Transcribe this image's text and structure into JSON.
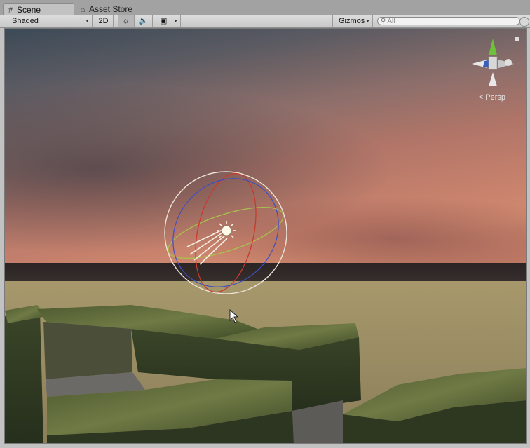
{
  "tabs": [
    {
      "label": "Scene",
      "icon": "grid-icon",
      "active": true
    },
    {
      "label": "Asset Store",
      "icon": "store-icon",
      "active": false
    }
  ],
  "toolbar": {
    "draw_mode": "Shaded",
    "btn_2d": "2D",
    "gizmos": "Gizmos",
    "search_placeholder": "All"
  },
  "viewport": {
    "projection_label": "Persp",
    "sky_colors": [
      "#3c4a57",
      "#b07568",
      "#d28a6f"
    ],
    "ground_color": "#a7986c"
  }
}
